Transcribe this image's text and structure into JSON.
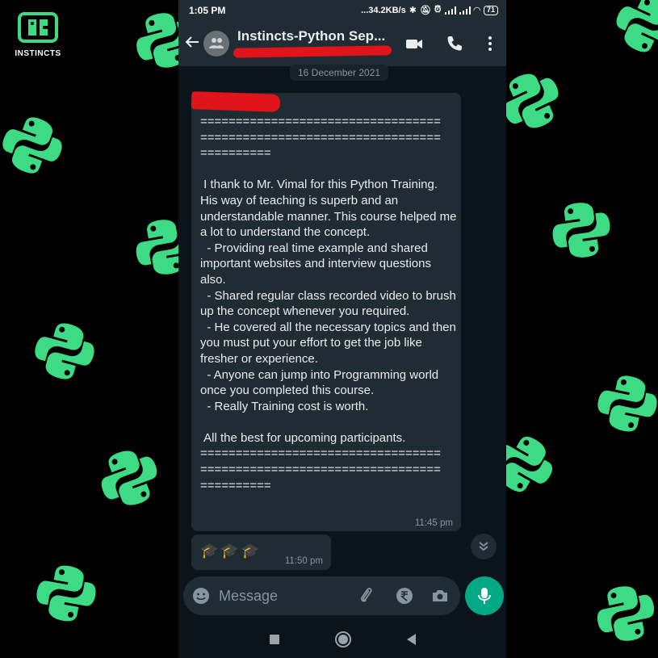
{
  "brand": {
    "name": "INSTINCTS"
  },
  "status_bar": {
    "time": "1:05 PM",
    "network_speed": "...34.2KB/s",
    "battery": "71"
  },
  "app_bar": {
    "title": "Instincts-Python Sep...",
    "back_icon": "arrow-left-icon",
    "avatar_icon": "group-icon",
    "video_icon": "videocam-icon",
    "call_icon": "phone-icon",
    "menu_icon": "more-vert-icon"
  },
  "chat": {
    "date_label": "16 December 2021",
    "messages": [
      {
        "text": "==================================\n==================================\n==========\n\n I thank to Mr. Vimal for this Python Training. His way of teaching is superb and an understandable manner. This course helped me a lot to understand the concept.\n  - Providing real time example and shared important websites and interview questions also.\n  - Shared regular class recorded video to brush up the concept whenever you required.\n  - He covered all the necessary topics and then you must put your effort to get the job like fresher or experience.\n  - Anyone can jump into Programming world once you completed this course.\n  - Really Training cost is worth.\n\n All the best for upcoming participants.\n==================================\n==================================\n==========",
        "time": "11:45 pm"
      },
      {
        "text": "🎓🎓🎓",
        "time": "11:50 pm"
      }
    ]
  },
  "composer": {
    "placeholder": "Message",
    "emoji_icon": "emoji-icon",
    "attach_icon": "paperclip-icon",
    "payment_icon": "rupee-icon",
    "camera_icon": "camera-icon",
    "mic_icon": "mic-icon"
  },
  "colors": {
    "accent": "#00a884",
    "bubble": "#202c33",
    "header": "#1f2c33",
    "python_green": "#3ddc84"
  }
}
